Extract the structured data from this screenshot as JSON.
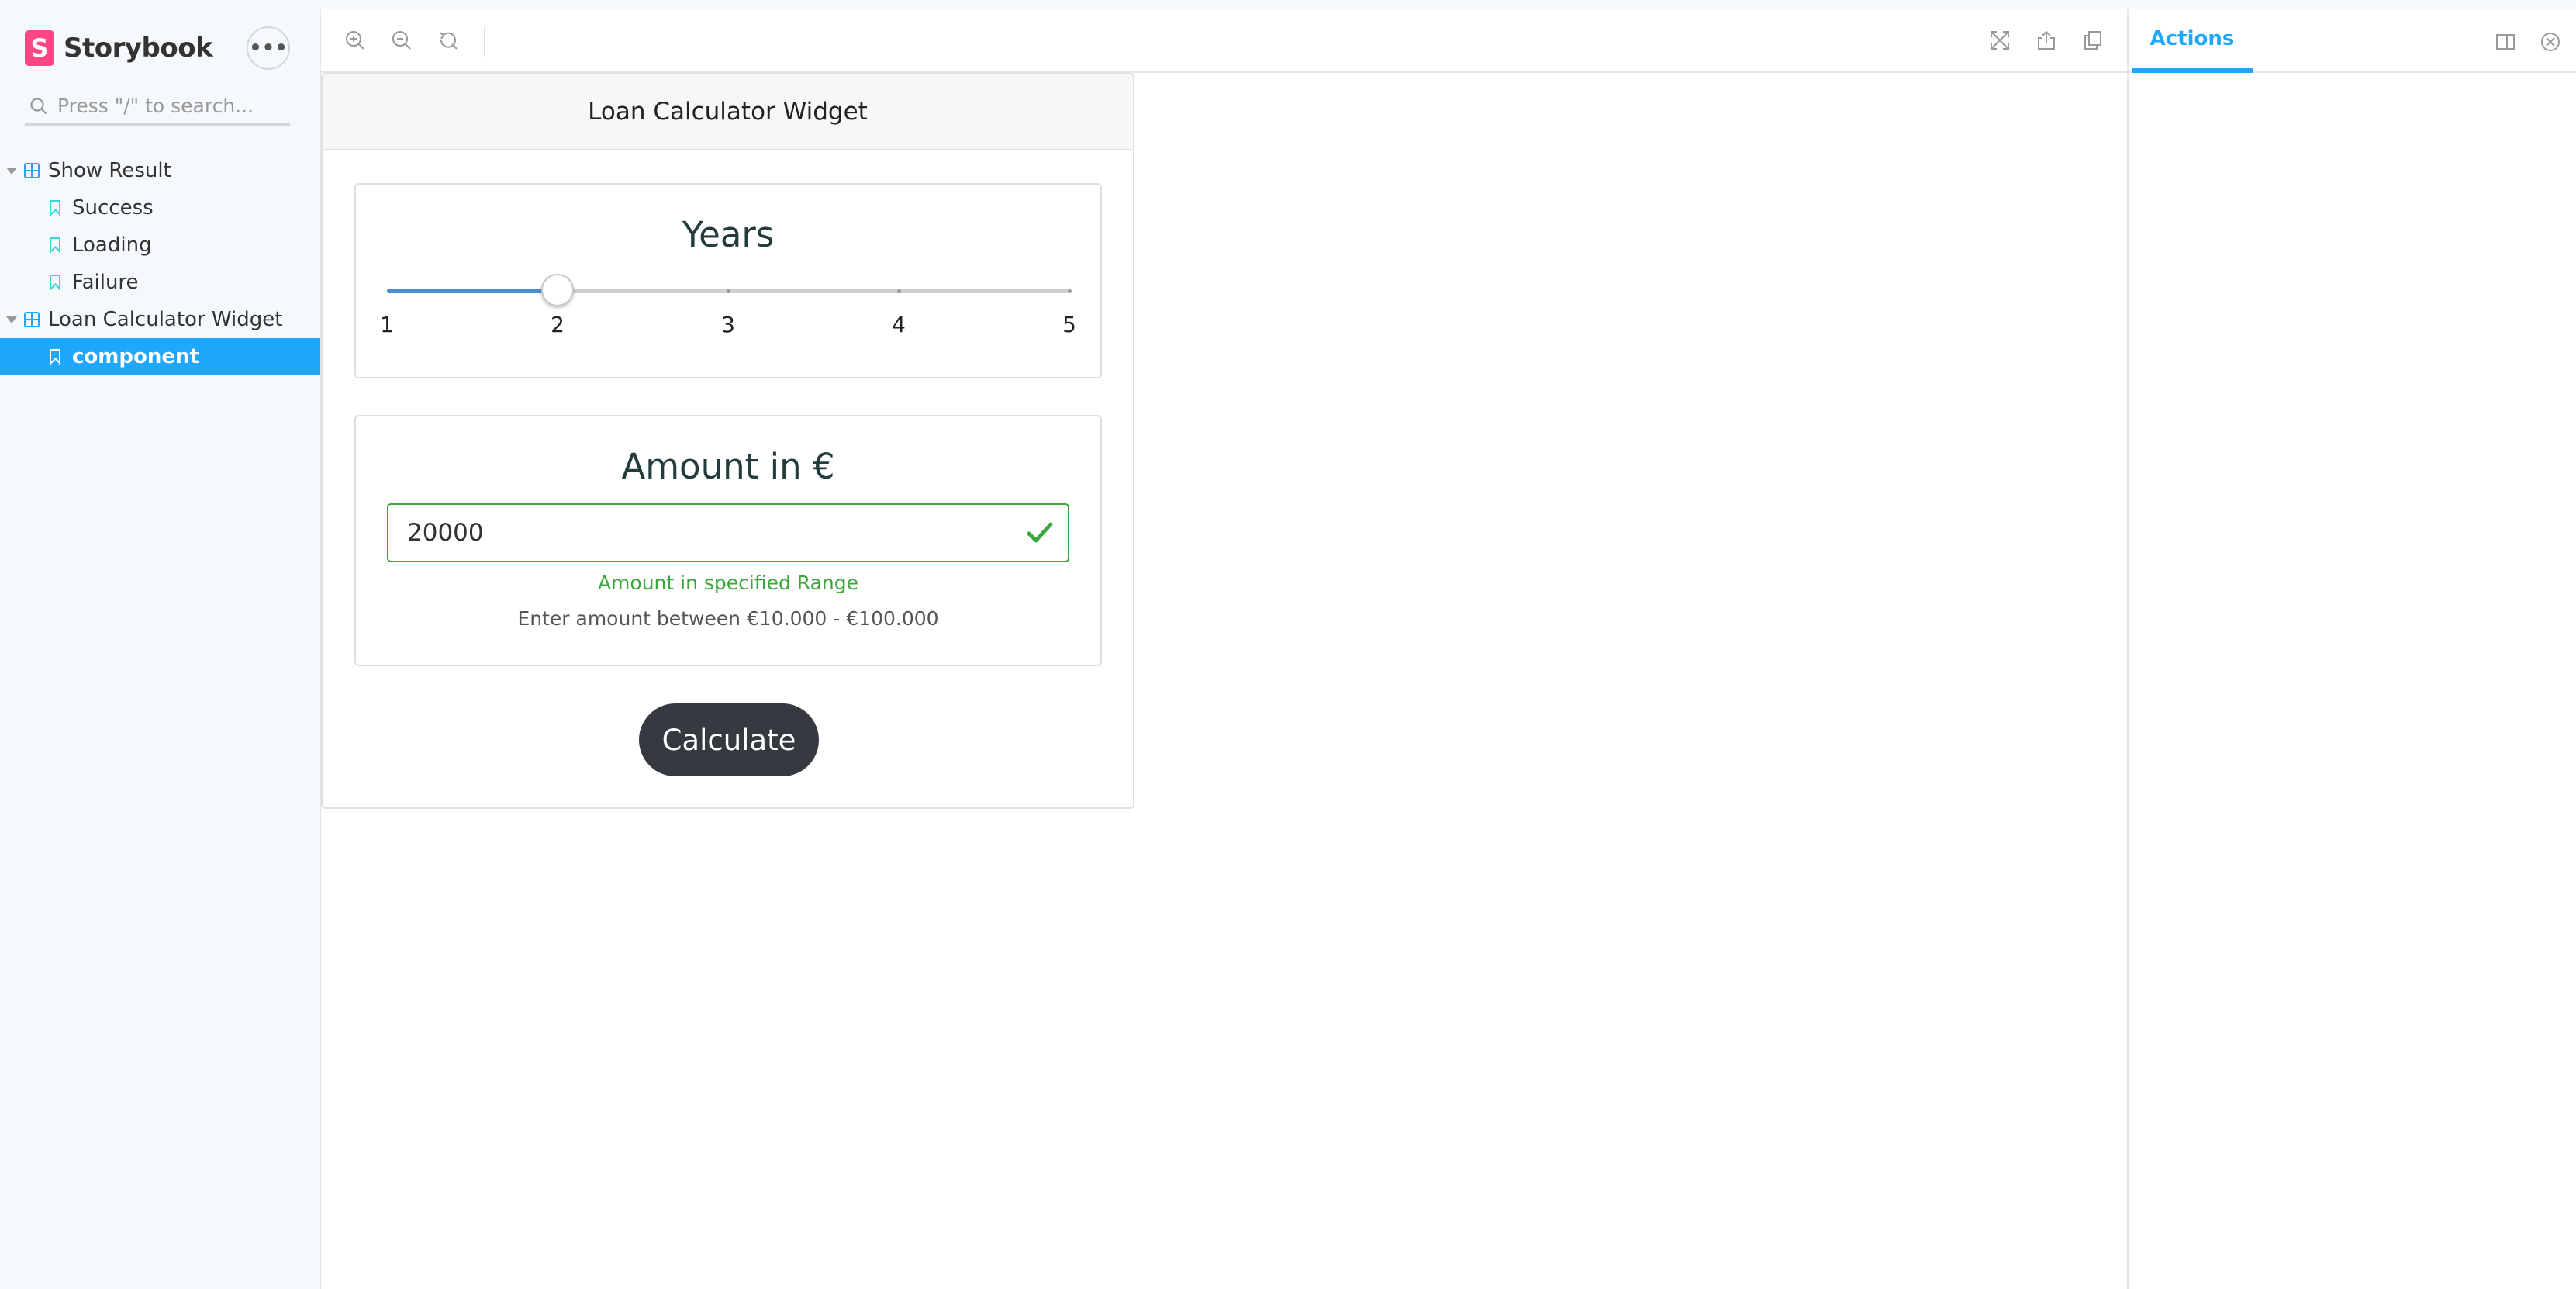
{
  "sidebar": {
    "brand": "Storybook",
    "brand_logo_letter": "S",
    "menu_label": "•••",
    "search_placeholder": "Press \"/\" to search...",
    "tree": [
      {
        "label": "Show Result",
        "type": "component",
        "expanded": true
      },
      {
        "label": "Success",
        "type": "story"
      },
      {
        "label": "Loading",
        "type": "story"
      },
      {
        "label": "Failure",
        "type": "story"
      },
      {
        "label": "Loan Calculator Widget",
        "type": "component",
        "expanded": true
      },
      {
        "label": "component",
        "type": "story",
        "selected": true
      }
    ]
  },
  "toolbar": {
    "left_icons": [
      "zoom-in-icon",
      "zoom-out-icon",
      "reset-zoom-icon"
    ],
    "right_icons": [
      "fullscreen-icon",
      "share-icon",
      "copy-icon"
    ]
  },
  "addons": {
    "active_tab": "Actions",
    "icons": [
      "panel-orientation-icon",
      "close-icon"
    ]
  },
  "widget": {
    "title": "Loan Calculator Widget",
    "years": {
      "title": "Years",
      "ticks": [
        "1",
        "2",
        "3",
        "4",
        "5"
      ],
      "value": 2,
      "min": 1,
      "max": 5
    },
    "amount": {
      "title": "Amount in €",
      "value": "20000",
      "valid_message": "Amount in specified Range",
      "hint": "Enter amount between €10.000 - €100.000"
    },
    "calculate_label": "Calculate"
  },
  "colors": {
    "accent": "#1ea7fd",
    "brand": "#ff4785",
    "slider_fill": "#4a8ed3",
    "valid": "#3aa63d",
    "button": "#343a40"
  }
}
